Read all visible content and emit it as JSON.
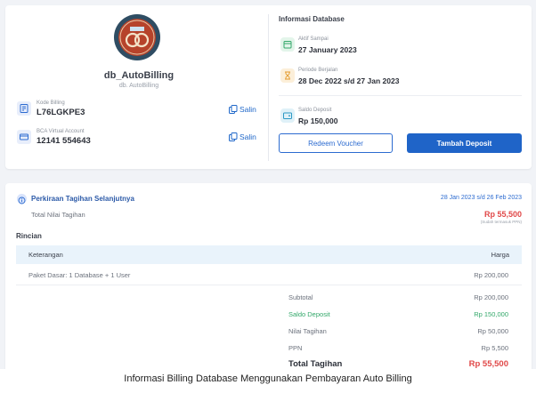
{
  "database": {
    "name": "db_AutoBilling",
    "subtitle": "db. AutoBilling",
    "kode_billing_label": "Kode Billing",
    "kode_billing_value": "L76LGKPE3",
    "va_label": "BCA Virtual Account",
    "va_value": "12141 554643",
    "copy_label": "Salin"
  },
  "info": {
    "title": "Informasi Database",
    "active_label": "Aktif Sampai",
    "active_value": "27 January 2023",
    "period_label": "Periode Berjalan",
    "period_value": "28 Dec 2022 s/d 27 Jan 2023",
    "deposit_label": "Saldo Deposit",
    "deposit_value": "Rp 150,000",
    "redeem_button": "Redeem Voucher",
    "add_deposit_button": "Tambah Deposit"
  },
  "estimate": {
    "title": "Perkiraan Tagihan Selanjutnya",
    "period": "28 Jan 2023 s/d 26 Feb 2023",
    "total_label": "Total Nilai Tagihan",
    "total_value": "Rp 55,500",
    "total_note": "(Sudah termasuk PPN)",
    "rincian_label": "Rincian",
    "table_headers": {
      "left": "Keterangan",
      "right": "Harga"
    },
    "rows": [
      {
        "label": "Paket Dasar: 1 Database + 1 User",
        "price": "Rp 200,000"
      }
    ],
    "summary": {
      "subtotal_label": "Subtotal",
      "subtotal_value": "Rp 200,000",
      "deposit_label": "Saldo Deposit",
      "deposit_value": "Rp 150,000",
      "nilai_label": "Nilai Tagihan",
      "nilai_value": "Rp 50,000",
      "ppn_label": "PPN",
      "ppn_value": "Rp 5,500",
      "total_label": "Total Tagihan",
      "total_value": "Rp 55,500"
    }
  },
  "caption": "Informasi Billing Database Menggunakan Pembayaran Auto Billing",
  "colors": {
    "accent": "#1f64c8",
    "danger": "#e04848",
    "success": "#33a86a",
    "background": "#f1f3f7"
  }
}
